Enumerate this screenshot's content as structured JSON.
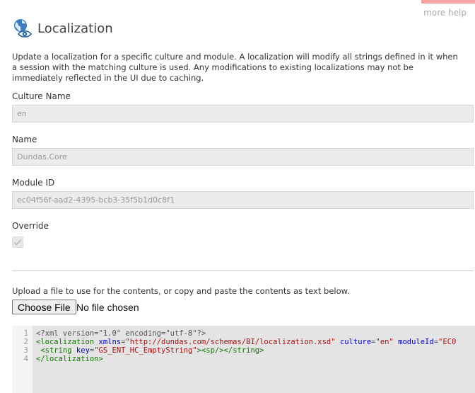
{
  "header": {
    "title": "Localization",
    "help_link": "more help",
    "icon": "globe-eye-icon"
  },
  "description": "Update a localization for a specific culture and module. A localization will modify all strings defined in it when a session with the matching culture is used. Any modifications to existing localizations may not be immediately reflected in the UI due to caching.",
  "fields": {
    "culture_name": {
      "label": "Culture Name",
      "value": "en"
    },
    "name": {
      "label": "Name",
      "value": "Dundas.Core"
    },
    "module_id": {
      "label": "Module ID",
      "value": "ec04f56f-aad2-4395-bcb3-35f5b1d0c8f1"
    },
    "override": {
      "label": "Override",
      "checked": true
    }
  },
  "upload": {
    "instruction": "Upload a file to use for the contents, or copy and paste the contents as text below.",
    "button_label": "Choose File",
    "file_status": "No file chosen"
  },
  "editor": {
    "line_numbers": [
      "1",
      "2",
      "3",
      "4"
    ],
    "lines": [
      [
        {
          "t": "pi",
          "v": "<?xml version=\"1.0\" encoding=\"utf-8\"?>"
        }
      ],
      [
        {
          "t": "tag",
          "v": "<localization"
        },
        {
          "t": "txt",
          "v": " "
        },
        {
          "t": "attr",
          "v": "xmlns"
        },
        {
          "t": "txt",
          "v": "="
        },
        {
          "t": "str",
          "v": "\"http://dundas.com/schemas/BI/localization.xsd\""
        },
        {
          "t": "txt",
          "v": " "
        },
        {
          "t": "attr",
          "v": "culture"
        },
        {
          "t": "txt",
          "v": "="
        },
        {
          "t": "str",
          "v": "\"en\""
        },
        {
          "t": "txt",
          "v": " "
        },
        {
          "t": "attr",
          "v": "moduleId"
        },
        {
          "t": "txt",
          "v": "="
        },
        {
          "t": "str",
          "v": "\"EC0"
        }
      ],
      [
        {
          "t": "txt",
          "v": "  "
        },
        {
          "t": "tag",
          "v": "<string"
        },
        {
          "t": "txt",
          "v": " "
        },
        {
          "t": "attr",
          "v": "key"
        },
        {
          "t": "txt",
          "v": "="
        },
        {
          "t": "str",
          "v": "\"GS_ENT_HC_EmptyString\""
        },
        {
          "t": "tag",
          "v": "><sp/></string>"
        }
      ],
      [
        {
          "t": "tag",
          "v": "</localization>"
        }
      ]
    ]
  }
}
